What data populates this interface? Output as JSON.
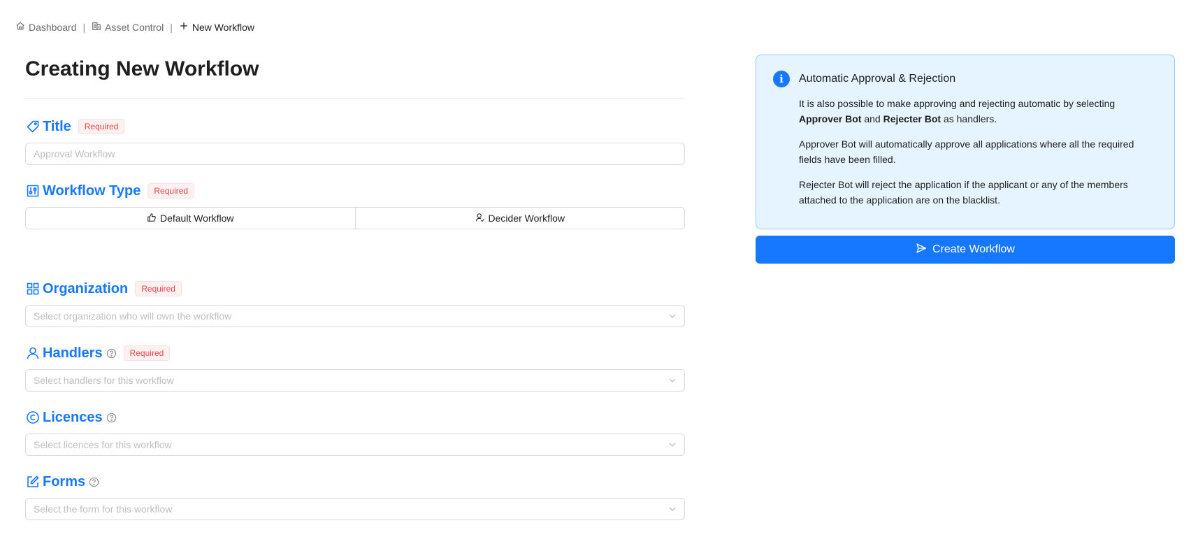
{
  "breadcrumb": {
    "items": [
      {
        "label": "Dashboard",
        "icon": "home-icon"
      },
      {
        "label": "Asset Control",
        "icon": "building-icon"
      },
      {
        "label": "New Workflow",
        "icon": "plus-icon"
      }
    ],
    "separator": "|"
  },
  "page": {
    "title": "Creating New Workflow"
  },
  "required_label": "Required",
  "form": {
    "title": {
      "label": "Title",
      "placeholder": "Approval Workflow",
      "icon": "tag-icon"
    },
    "workflow_type": {
      "label": "Workflow Type",
      "icon": "sliders-icon",
      "options": [
        {
          "label": "Default Workflow",
          "icon": "thumbs-up-icon"
        },
        {
          "label": "Decider Workflow",
          "icon": "user-check-icon"
        }
      ]
    },
    "organization": {
      "label": "Organization",
      "placeholder": "Select organization who will own the workflow",
      "icon": "grid-icon"
    },
    "handlers": {
      "label": "Handlers",
      "placeholder": "Select handlers for this workflow",
      "icon": "user-icon"
    },
    "licences": {
      "label": "Licences",
      "placeholder": "Select licences for this workflow",
      "icon": "copyright-icon"
    },
    "forms": {
      "label": "Forms",
      "placeholder": "Select the form for this workflow",
      "icon": "edit-icon"
    }
  },
  "info": {
    "title": "Automatic Approval & Rejection",
    "p1_a": "It is also possible to make approving and rejecting automatic by selecting ",
    "p1_b1": "Approver Bot",
    "p1_c": " and ",
    "p1_b2": "Rejecter Bot",
    "p1_d": " as handlers.",
    "p2": "Approver Bot will automatically approve all applications where all the required fields have been filled.",
    "p3": "Rejecter Bot will reject the application if the applicant or any of the members attached to the application are on the blacklist."
  },
  "actions": {
    "create_label": "Create Workflow"
  },
  "colors": {
    "accent": "#1677ff",
    "required_text": "#e0454b",
    "info_bg": "#e6f4ff",
    "info_border": "#91caff"
  }
}
